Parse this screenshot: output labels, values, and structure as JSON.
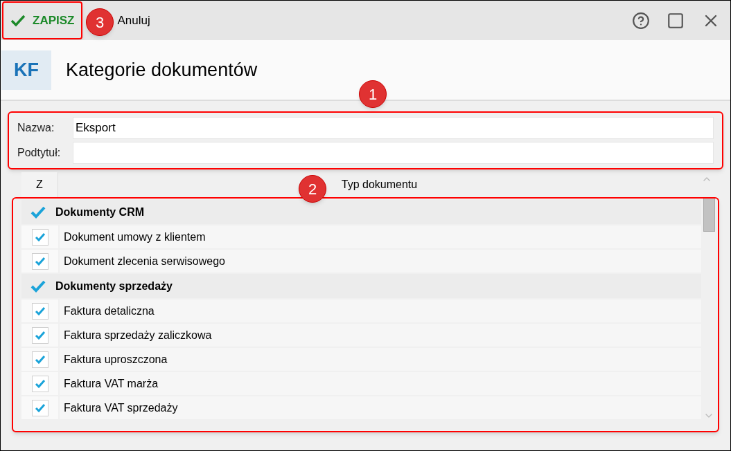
{
  "toolbar": {
    "save": "ZAPISZ",
    "cancel": "Anuluj"
  },
  "header": {
    "badge": "KF",
    "title": "Kategorie dokumentów"
  },
  "form": [
    {
      "label": "Nazwa:",
      "value": "Eksport"
    },
    {
      "label": "Podtytuł:"
    }
  ],
  "table": {
    "columns": [
      "Z",
      "Typ dokumentu"
    ],
    "rows": [
      {
        "kind": "group",
        "label": "Dokumenty CRM",
        "checked": true
      },
      {
        "kind": "item",
        "label": "Dokument umowy z klientem",
        "checked": true
      },
      {
        "kind": "item",
        "label": "Dokument zlecenia serwisowego",
        "checked": true
      },
      {
        "kind": "group",
        "label": "Dokumenty sprzedaży",
        "checked": true
      },
      {
        "kind": "item",
        "label": "Faktura detaliczna",
        "checked": true
      },
      {
        "kind": "item",
        "label": "Faktura sprzedaży zaliczkowa",
        "checked": true
      },
      {
        "kind": "item",
        "label": "Faktura uproszczona",
        "checked": true
      },
      {
        "kind": "item",
        "label": "Faktura VAT marża",
        "checked": true
      },
      {
        "kind": "item",
        "label": "Faktura VAT sprzedaży",
        "checked": true
      }
    ]
  },
  "callouts": [
    "1",
    "2",
    "3"
  ]
}
